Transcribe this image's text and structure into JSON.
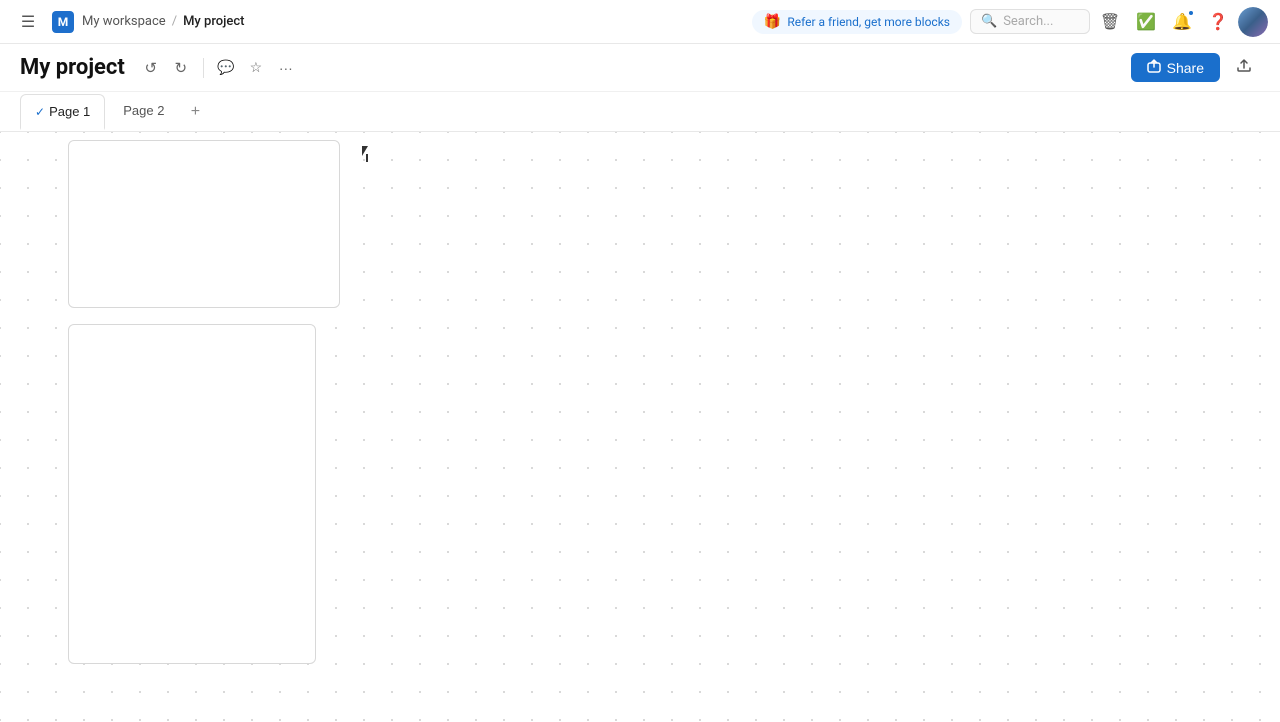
{
  "nav": {
    "hamburger_label": "☰",
    "workspace_initial": "M",
    "workspace_name": "My workspace",
    "breadcrumb_sep": "/",
    "project_name": "My project",
    "refer_text": "Refer a friend, get more blocks",
    "search_placeholder": "Search...",
    "search_label": "Search"
  },
  "toolbar": {
    "title": "My project",
    "undo_label": "↺",
    "redo_label": "↻",
    "comment_label": "💬",
    "star_label": "☆",
    "more_label": "···",
    "share_label": "Share",
    "export_label": "⬆"
  },
  "tabs": {
    "items": [
      {
        "label": "Page 1",
        "active": true
      },
      {
        "label": "Page 2",
        "active": false
      }
    ],
    "add_label": "+"
  },
  "canvas": {
    "cards": [
      {
        "id": "card-1"
      },
      {
        "id": "card-2"
      }
    ]
  }
}
